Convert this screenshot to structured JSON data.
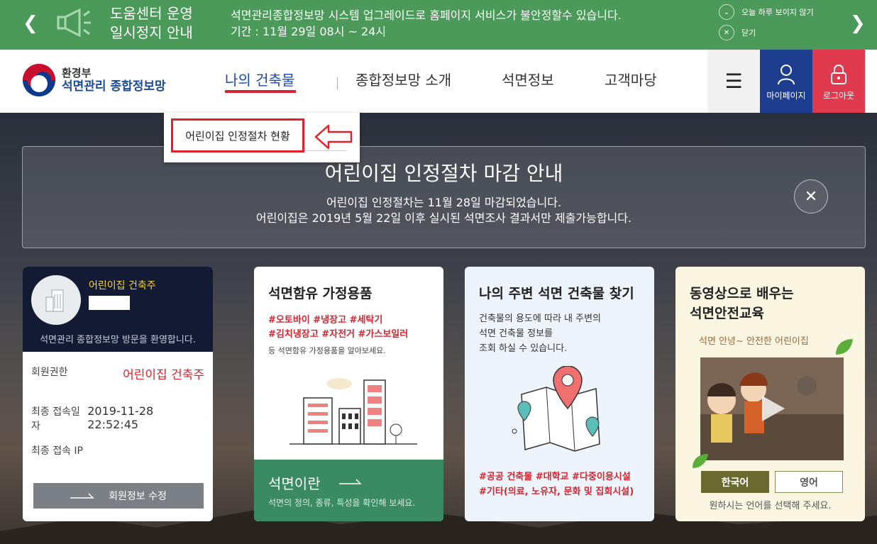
{
  "notice": {
    "title_line1": "도움센터 운영",
    "title_line2": "일시정지 안내",
    "message": "석면관리종합정보망 시스템 업그레이드로 홈페이지 서비스가 불안정할수 있습니다.",
    "period": "기간 : 11월 29일 08시 ~ 24시",
    "hide_today": "오늘 하루 보이지 않기",
    "close": "닫기",
    "bg_color": "#4b9a5a"
  },
  "header": {
    "logo_ministry": "환경부",
    "logo_name": "석면관리 종합정보망",
    "nav": [
      "나의 건축물",
      "종합정보망 소개",
      "석면정보",
      "고객마당"
    ],
    "mypage": "마이페이지",
    "logout": "로그아웃",
    "accent_blue": "#1d3d8f",
    "accent_red": "#e03a4e"
  },
  "dropdown": {
    "item": "어린이집 인정절차 현황"
  },
  "announcement": {
    "title": "어린이집 인정절차 마감 안내",
    "line1": "어린이집 인정절차는 11월 28일 마감되었습니다.",
    "line2": "어린이집은 2019년 5월 22일 이후 실시된 석면조사 결과서만 제출가능합니다."
  },
  "user": {
    "role_label": "어린이집 건축주",
    "welcome": "석면관리 종합정보망 방문을 환영합니다.",
    "rows": [
      {
        "label": "회원권한",
        "value": "어린이집 건축주"
      },
      {
        "label": "최종 접속일자",
        "value": "2019-11-28 22:52:45"
      },
      {
        "label": "최종 접속 IP",
        "value": ""
      }
    ],
    "edit_button": "회원정보 수정"
  },
  "cards": {
    "household": {
      "title": "석면함유 가정용품",
      "tags_line1": "#오토바이 #냉장고 #세탁기",
      "tags_line2": "#김치냉장고 #자전거 #가스보일러",
      "desc": "등 석면함유 가정용품을 알아보세요.",
      "footer_title": "석면이란",
      "footer_desc": "석면의 정의, 종류, 특성을 확인해 보세요."
    },
    "nearby": {
      "title": "나의 주변 석면 건축물 찾기",
      "desc_line1": "건축물의 용도에 따라 내 주변의",
      "desc_line2": "석면 건축물 정보를",
      "desc_line3": "조회 하실 수 있습니다.",
      "tags_line1": "#공공 건축물 #대학교 #다중이용시설",
      "tags_line2": "#기타(의료, 노유자, 문화 및 집회시설)"
    },
    "video": {
      "title_line1": "동영상으로 배우는",
      "title_line2": "석면안전교육",
      "subtitle": "석면 안녕~ 안전한 어린이집",
      "lang_ko": "한국어",
      "lang_en": "영어",
      "hint": "원하시는 언어를 선택해 주세요."
    }
  }
}
